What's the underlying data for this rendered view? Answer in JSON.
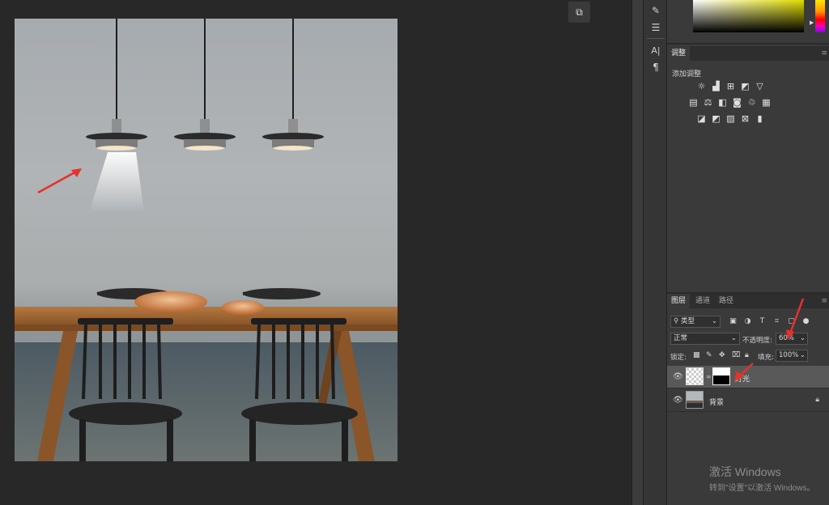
{
  "workspace": {
    "arrange_icon": "arrange-documents-icon"
  },
  "tools": {
    "items": [
      "brush-settings-icon",
      "adjust-sliders-icon",
      "character-icon",
      "paragraph-icon"
    ],
    "character_glyph": "A|",
    "paragraph_glyph": "¶"
  },
  "colors": {
    "red_arrow": "#e8302c",
    "selected_row": "#595959",
    "panel_bg": "#3a3a3a"
  },
  "adjustments": {
    "tab_label": "调整",
    "add_label": "添加调整",
    "row1": [
      "brightness-contrast-icon",
      "levels-icon",
      "curves-icon",
      "exposure-icon",
      "vibrance-icon"
    ],
    "row2": [
      "hue-saturation-icon",
      "color-balance-icon",
      "black-white-icon",
      "photo-filter-icon",
      "channel-mixer-icon",
      "color-lookup-icon"
    ],
    "row3": [
      "invert-icon",
      "posterize-icon",
      "threshold-icon",
      "selective-color-icon",
      "gradient-map-icon"
    ]
  },
  "layers": {
    "tabs": [
      "图层",
      "通道",
      "路径"
    ],
    "filter_kind": "类型",
    "blend_mode": "正常",
    "opacity_label": "不透明度:",
    "opacity_value": "60%",
    "lock_label": "锁定:",
    "fill_label": "填充:",
    "fill_value": "100%",
    "rows": [
      {
        "name": "灯光",
        "visible": true,
        "selected": true
      },
      {
        "name": "背景",
        "visible": true,
        "selected": false,
        "locked": true
      }
    ]
  },
  "watermark": {
    "line1": "激活 Windows",
    "line2": "转到\"设置\"以激活 Windows。"
  }
}
